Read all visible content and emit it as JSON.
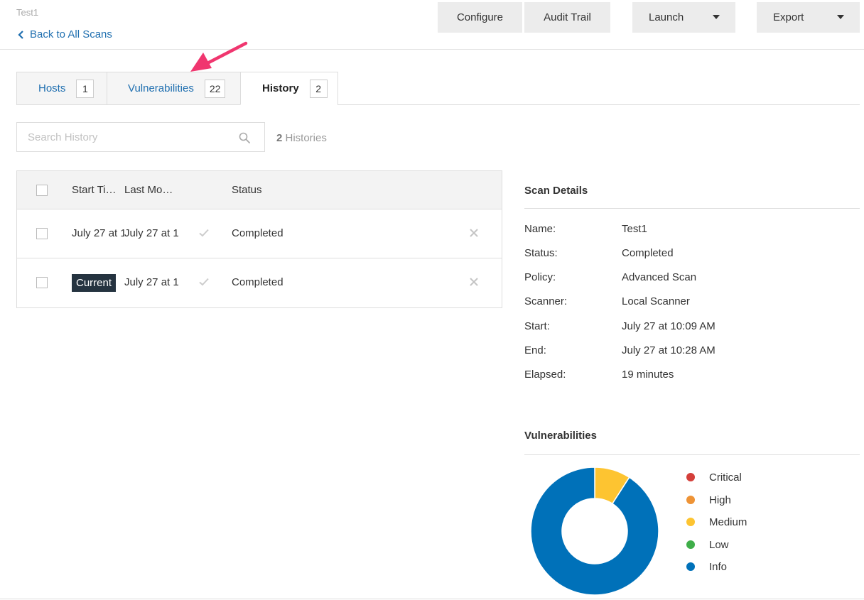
{
  "header": {
    "scan_name": "Test1",
    "back_label": "Back to All Scans",
    "buttons": {
      "configure": "Configure",
      "audit_trail": "Audit Trail",
      "launch": "Launch",
      "export": "Export"
    }
  },
  "tabs": [
    {
      "label": "Hosts",
      "count": "1"
    },
    {
      "label": "Vulnerabilities",
      "count": "22"
    },
    {
      "label": "History",
      "count": "2"
    }
  ],
  "search": {
    "placeholder": "Search History",
    "count_number": "2",
    "count_label": " Histories"
  },
  "history_table": {
    "columns": {
      "start_time": "Start Ti…",
      "last_modified": "Last Mo…",
      "status": "Status"
    },
    "rows": [
      {
        "start": "July 27 at 1",
        "last_modified": "July 27 at 1",
        "status": "Completed"
      },
      {
        "badge": "Current",
        "last_modified": "July 27 at 1",
        "status": "Completed"
      }
    ]
  },
  "scan_details": {
    "title": "Scan Details",
    "rows": [
      {
        "key": "Name:",
        "value": "Test1"
      },
      {
        "key": "Status:",
        "value": "Completed"
      },
      {
        "key": "Policy:",
        "value": "Advanced Scan"
      },
      {
        "key": "Scanner:",
        "value": "Local Scanner"
      },
      {
        "key": "Start:",
        "value": "July 27 at 10:09 AM"
      },
      {
        "key": "End:",
        "value": "July 27 at 10:28 AM"
      },
      {
        "key": "Elapsed:",
        "value": "19 minutes"
      }
    ]
  },
  "vulnerabilities": {
    "title": "Vulnerabilities",
    "legend": [
      {
        "label": "Critical",
        "color": "#d43f3a"
      },
      {
        "label": "High",
        "color": "#ee9336"
      },
      {
        "label": "Medium",
        "color": "#fdc431"
      },
      {
        "label": "Low",
        "color": "#3fae49"
      },
      {
        "label": "Info",
        "color": "#0071b9"
      }
    ]
  },
  "chart_data": {
    "type": "pie",
    "categories": [
      "Critical",
      "High",
      "Medium",
      "Low",
      "Info"
    ],
    "values": [
      0,
      0,
      2,
      0,
      20
    ],
    "colors": [
      "#d43f3a",
      "#ee9336",
      "#fdc431",
      "#3fae49",
      "#0071b9"
    ],
    "title": "Vulnerabilities",
    "legend_position": "right"
  },
  "colors": {
    "link": "#1f6fb0",
    "badge_bg": "#253340",
    "annotation_arrow": "#f0366f"
  }
}
